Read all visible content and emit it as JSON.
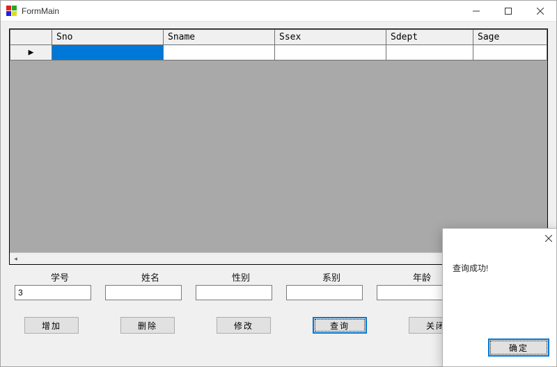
{
  "window": {
    "title": "FormMain"
  },
  "grid": {
    "columns": [
      "Sno",
      "Sname",
      "Ssex",
      "Sdept",
      "Sage"
    ],
    "rows": [
      {
        "selected_col": 0,
        "cells": [
          "",
          "",
          "",
          "",
          ""
        ]
      }
    ],
    "row_marker": "▶"
  },
  "labels": {
    "sno": "学号",
    "sname": "姓名",
    "ssex": "性别",
    "sdept": "系别",
    "sage": "年龄"
  },
  "inputs": {
    "sno": "3",
    "sname": "",
    "ssex": "",
    "sdept": "",
    "sage": ""
  },
  "buttons": {
    "add": "增加",
    "delete": "删除",
    "update": "修改",
    "query": "查询",
    "close": "关闭"
  },
  "popup": {
    "message": "查询成功!",
    "ok_label": "确定"
  }
}
